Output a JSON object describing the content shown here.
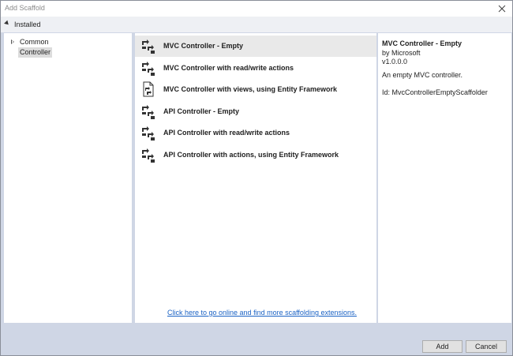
{
  "window": {
    "title": "Add Scaffold"
  },
  "installed": {
    "label": "Installed"
  },
  "tree": {
    "items": [
      {
        "label": "Common",
        "expandable": true,
        "selected": false
      },
      {
        "label": "Controller",
        "expandable": false,
        "selected": true
      }
    ]
  },
  "scaffolds": {
    "items": [
      {
        "label": "MVC Controller - Empty",
        "icon": "controller-icon",
        "selected": true
      },
      {
        "label": "MVC Controller with read/write actions",
        "icon": "controller-icon",
        "selected": false
      },
      {
        "label": "MVC Controller with views, using Entity Framework",
        "icon": "controller-views-icon",
        "selected": false
      },
      {
        "label": "API Controller - Empty",
        "icon": "controller-icon",
        "selected": false
      },
      {
        "label": "API Controller with read/write actions",
        "icon": "controller-icon",
        "selected": false
      },
      {
        "label": "API Controller with actions, using Entity Framework",
        "icon": "controller-icon",
        "selected": false
      }
    ],
    "online_link": "Click here to go online and find more scaffolding extensions."
  },
  "details": {
    "title": "MVC Controller - Empty",
    "author": "by Microsoft",
    "version": "v1.0.0.0",
    "description": "An empty MVC controller.",
    "id": "Id: MvcControllerEmptyScaffolder"
  },
  "buttons": {
    "add": "Add",
    "cancel": "Cancel"
  },
  "colors": {
    "link": "#1a62c4",
    "selection": "#e9e9e9",
    "dialog_background": "#cfd6e5"
  }
}
